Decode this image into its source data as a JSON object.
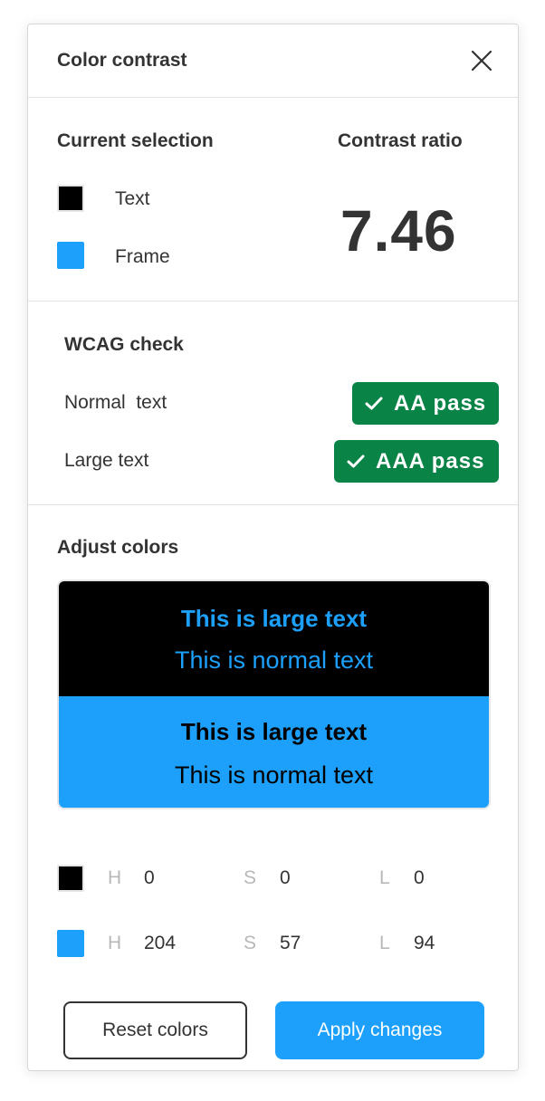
{
  "header": {
    "title": "Color contrast",
    "close_icon": "close-icon"
  },
  "selection": {
    "heading": "Current selection",
    "text_label": "Text",
    "frame_label": "Frame",
    "text_color": "#000000",
    "frame_color": "#1ca0fb"
  },
  "contrast": {
    "heading": "Contrast ratio",
    "ratio": "7.46"
  },
  "wcag": {
    "heading": "WCAG check",
    "normal_label": "Normal  text",
    "normal_badge": "AA pass",
    "large_label": "Large text",
    "large_badge": "AAA pass",
    "badge_icon": "checkmark-icon",
    "pass_color": "#0a8346"
  },
  "adjust": {
    "heading": "Adjust colors",
    "preview_dark": {
      "large_text": "This is large text",
      "normal_text": "This is normal text"
    },
    "preview_light": {
      "large_text": "This is large text",
      "normal_text": "This is normal text"
    },
    "text_color_hsl": {
      "h_label": "H",
      "h": "0",
      "s_label": "S",
      "s": "0",
      "l_label": "L",
      "l": "0"
    },
    "frame_color_hsl": {
      "h_label": "H",
      "h": "204",
      "s_label": "S",
      "s": "57",
      "l_label": "L",
      "l": "94"
    }
  },
  "actions": {
    "reset_label": "Reset colors",
    "apply_label": "Apply changes"
  },
  "colors": {
    "accent": "#1ca0fb",
    "pass": "#0a8346",
    "text": "#333333"
  }
}
